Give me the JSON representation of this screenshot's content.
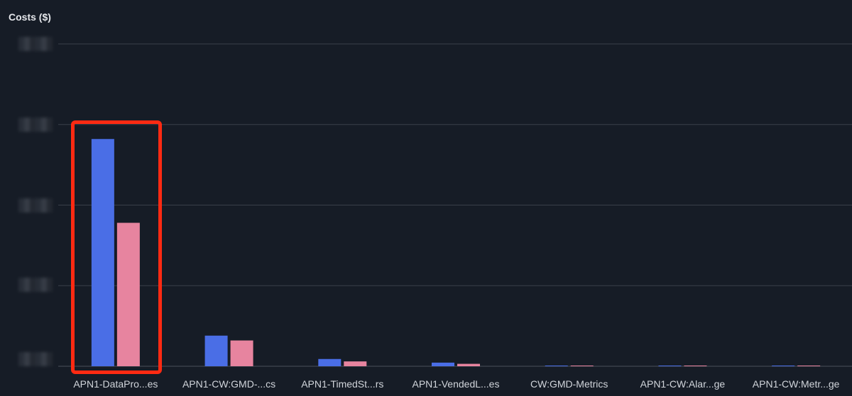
{
  "chart_data": {
    "type": "bar",
    "title": "",
    "ylabel": "Costs ($)",
    "xlabel": "",
    "categories": [
      "APN1-DataPro...es",
      "APN1-CW:GMD-...cs",
      "APN1-TimedSt...rs",
      "APN1-VendedL...es",
      "CW:GMD-Metrics",
      "APN1-CW:Alar...ge",
      "APN1-CW:Metr...ge"
    ],
    "series": [
      {
        "color": "#4a6ee6",
        "values": [
          282,
          38,
          9,
          4.5,
          0.8,
          0.6,
          0.5
        ]
      },
      {
        "color": "#e7849f",
        "values": [
          178,
          32,
          6,
          3,
          0.6,
          0.5,
          0.4
        ]
      }
    ],
    "ylim": [
      0,
      400
    ],
    "grid": true,
    "legend": "none"
  },
  "colors": {
    "background": "#161c26",
    "grid": "#3a404a",
    "text": "#d1d5db",
    "highlight": "#ff2a12"
  }
}
